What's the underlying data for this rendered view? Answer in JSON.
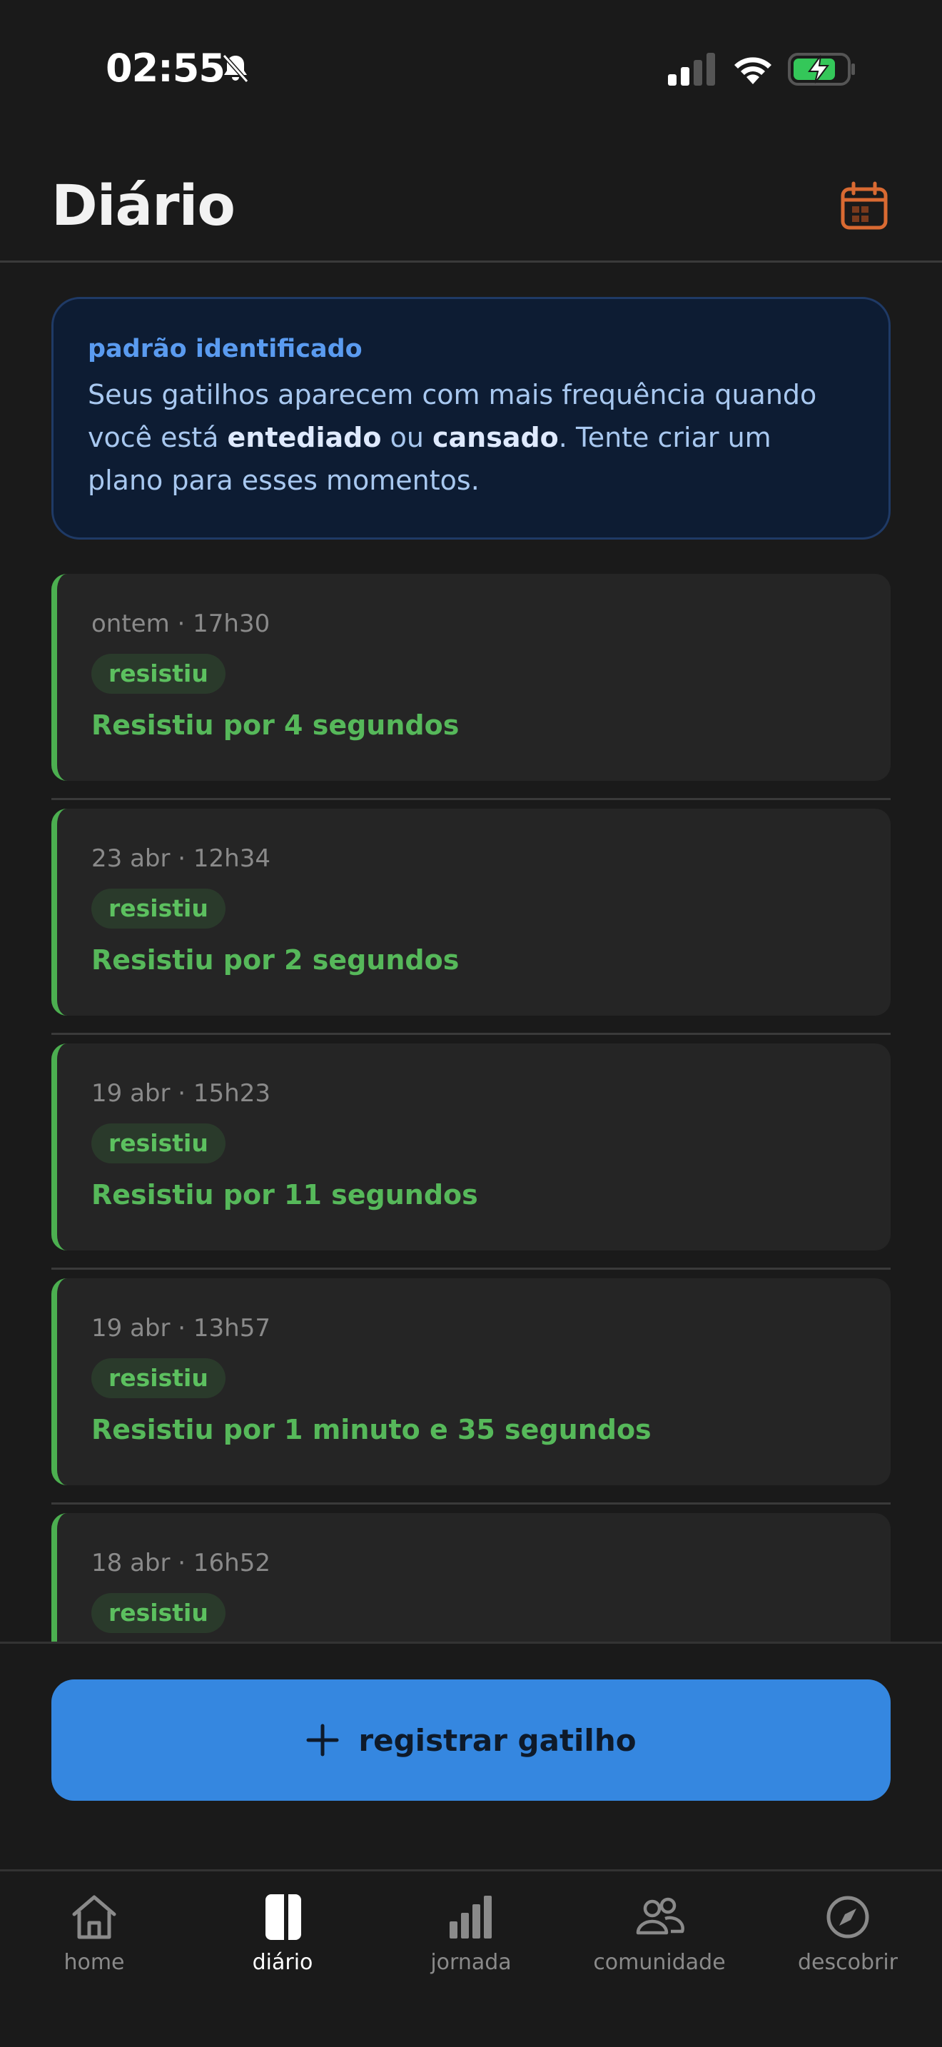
{
  "status_bar": {
    "time": "02:55",
    "icons": [
      "bell-slash-icon",
      "signal-icon",
      "wifi-icon",
      "battery-charging-icon"
    ]
  },
  "header": {
    "title": "Diário",
    "calendar_icon": "calendar-icon",
    "accent_color": "#d96a32"
  },
  "pattern": {
    "label": "padrão identificado",
    "text_part1": "Seus gatilhos aparecem com mais frequência quando você está ",
    "emph1": "entediado",
    "text_part2": " ou ",
    "emph2": "cansado",
    "text_part3": ". Tente criar um plano para esses momentos."
  },
  "entries": [
    {
      "date": "ontem · 17h30",
      "badge": "resistiu",
      "text": "Resistiu por 4 segundos"
    },
    {
      "date": "23 abr · 12h34",
      "badge": "resistiu",
      "text": "Resistiu por 2 segundos"
    },
    {
      "date": "19 abr · 15h23",
      "badge": "resistiu",
      "text": "Resistiu por 11 segundos"
    },
    {
      "date": "19 abr · 13h57",
      "badge": "resistiu",
      "text": "Resistiu por 1 minuto e 35 segundos"
    },
    {
      "date": "18 abr · 16h52",
      "badge": "resistiu",
      "text": ""
    }
  ],
  "register_button": {
    "label": "registrar gatilho",
    "color": "#3587e0"
  },
  "tabs": [
    {
      "label": "home",
      "icon": "home-icon"
    },
    {
      "label": "diário",
      "icon": "journal-icon",
      "active": true
    },
    {
      "label": "jornada",
      "icon": "bar-chart-icon"
    },
    {
      "label": "comunidade",
      "icon": "people-icon"
    },
    {
      "label": "descobrir",
      "icon": "compass-icon"
    }
  ]
}
